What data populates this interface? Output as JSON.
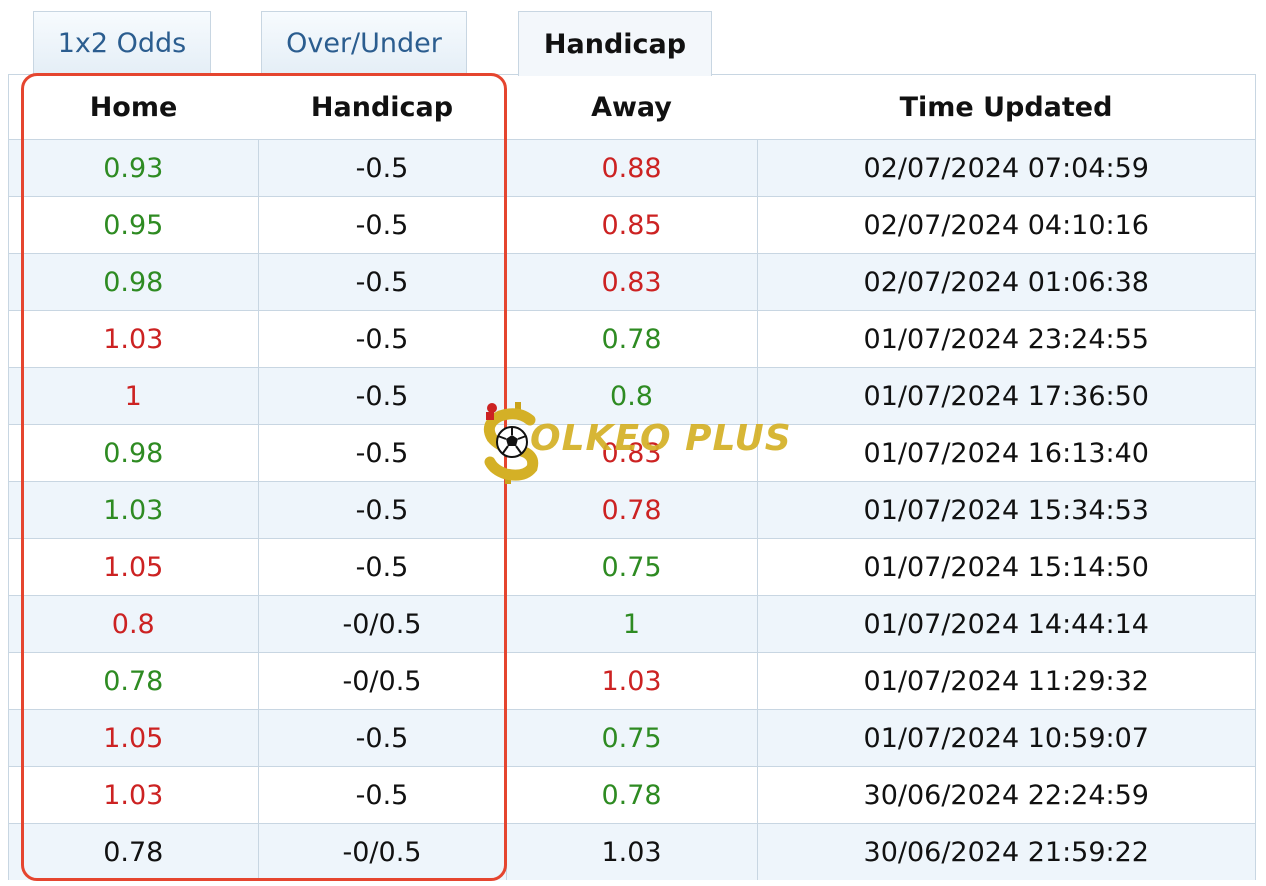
{
  "tabs": [
    {
      "label": "1x2 Odds",
      "active": false
    },
    {
      "label": "Over/Under",
      "active": false
    },
    {
      "label": "Handicap",
      "active": true
    }
  ],
  "table": {
    "headers": [
      "Home",
      "Handicap",
      "Away",
      "Time Updated"
    ],
    "rows": [
      {
        "home": "0.93",
        "home_color": "green",
        "handicap": "-0.5",
        "away": "0.88",
        "away_color": "red",
        "time": "02/07/2024 07:04:59"
      },
      {
        "home": "0.95",
        "home_color": "green",
        "handicap": "-0.5",
        "away": "0.85",
        "away_color": "red",
        "time": "02/07/2024 04:10:16"
      },
      {
        "home": "0.98",
        "home_color": "green",
        "handicap": "-0.5",
        "away": "0.83",
        "away_color": "red",
        "time": "02/07/2024 01:06:38"
      },
      {
        "home": "1.03",
        "home_color": "red",
        "handicap": "-0.5",
        "away": "0.78",
        "away_color": "green",
        "time": "01/07/2024 23:24:55"
      },
      {
        "home": "1",
        "home_color": "red",
        "handicap": "-0.5",
        "away": "0.8",
        "away_color": "green",
        "time": "01/07/2024 17:36:50"
      },
      {
        "home": "0.98",
        "home_color": "green",
        "handicap": "-0.5",
        "away": "0.83",
        "away_color": "red",
        "time": "01/07/2024 16:13:40"
      },
      {
        "home": "1.03",
        "home_color": "green",
        "handicap": "-0.5",
        "away": "0.78",
        "away_color": "red",
        "time": "01/07/2024 15:34:53"
      },
      {
        "home": "1.05",
        "home_color": "red",
        "handicap": "-0.5",
        "away": "0.75",
        "away_color": "green",
        "time": "01/07/2024 15:14:50"
      },
      {
        "home": "0.8",
        "home_color": "red",
        "handicap": "-0/0.5",
        "away": "1",
        "away_color": "green",
        "time": "01/07/2024 14:44:14"
      },
      {
        "home": "0.78",
        "home_color": "green",
        "handicap": "-0/0.5",
        "away": "1.03",
        "away_color": "red",
        "time": "01/07/2024 11:29:32"
      },
      {
        "home": "1.05",
        "home_color": "red",
        "handicap": "-0.5",
        "away": "0.75",
        "away_color": "green",
        "time": "01/07/2024 10:59:07"
      },
      {
        "home": "1.03",
        "home_color": "red",
        "handicap": "-0.5",
        "away": "0.78",
        "away_color": "green",
        "time": "30/06/2024 22:24:59"
      },
      {
        "home": "0.78",
        "home_color": "black",
        "handicap": "-0/0.5",
        "away": "1.03",
        "away_color": "black",
        "time": "30/06/2024 21:59:22"
      }
    ]
  },
  "colors": {
    "green": "#2e8b22",
    "red": "#cc2222",
    "black": "#111111",
    "highlight": "#e5452f"
  },
  "watermark": {
    "text": "OLKEO PLUS",
    "icon": "soccer-ball-dollar-logo-icon"
  }
}
